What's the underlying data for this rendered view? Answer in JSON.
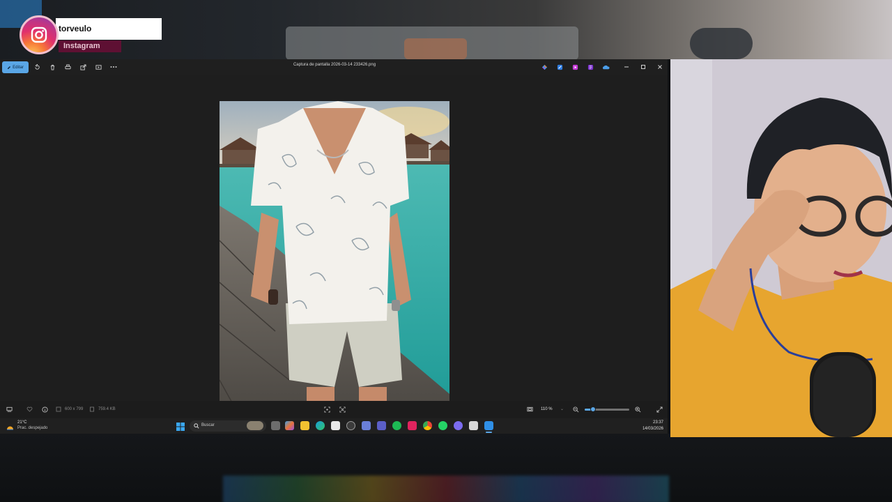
{
  "overlay": {
    "username": "torveulo",
    "platform": "Instagram"
  },
  "app": {
    "edit_label": "Editar",
    "title": "Captura de pantalla 2026-03-14 233426.png",
    "toolbar_icons": [
      "rotate-icon",
      "delete-icon",
      "print-icon",
      "share-icon",
      "slideshow-icon",
      "more-icon"
    ],
    "ai_icons": [
      "copilot-icon",
      "designer-icon",
      "clipchamp-icon",
      "onenote-icon",
      "onedrive-icon"
    ],
    "window_controls": [
      "minimize-icon",
      "maximize-icon",
      "close-icon"
    ]
  },
  "status": {
    "dimensions": "600 x 799",
    "file_size": "759.4 KB",
    "zoom": "110 %",
    "zoom_level": 0.18
  },
  "taskbar": {
    "temperature": "21°C",
    "weather": "Prac. despejado",
    "search_placeholder": "Buscar",
    "time": "23:37",
    "date": "14/03/2026"
  },
  "colors": {
    "accent": "#5aa6e6",
    "window_bg": "#1e1e1e",
    "instagram_tag": "#5e1033"
  }
}
